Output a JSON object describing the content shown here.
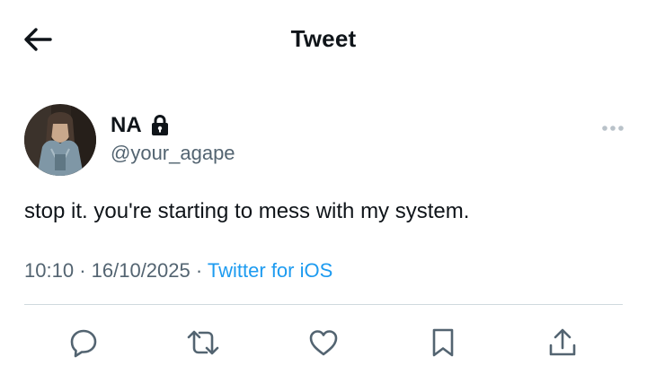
{
  "header": {
    "title": "Tweet",
    "back_icon": "arrow-left-icon"
  },
  "tweet": {
    "author": {
      "display_name": "NA",
      "handle": "@your_agape",
      "protected_icon": "lock-icon"
    },
    "text": "stop it. you're starting to mess with my system.",
    "time": "10:10",
    "date": "16/10/2025",
    "separator": "·",
    "source": "Twitter for iOS"
  },
  "actions": [
    {
      "name": "reply",
      "icon": "reply-icon"
    },
    {
      "name": "retweet",
      "icon": "retweet-icon"
    },
    {
      "name": "like",
      "icon": "heart-icon"
    },
    {
      "name": "bookmark",
      "icon": "bookmark-icon"
    },
    {
      "name": "share",
      "icon": "share-icon"
    }
  ],
  "colors": {
    "text_primary": "#0f1419",
    "text_secondary": "#536471",
    "link": "#1d9bf0",
    "divider": "#cfd9de"
  }
}
